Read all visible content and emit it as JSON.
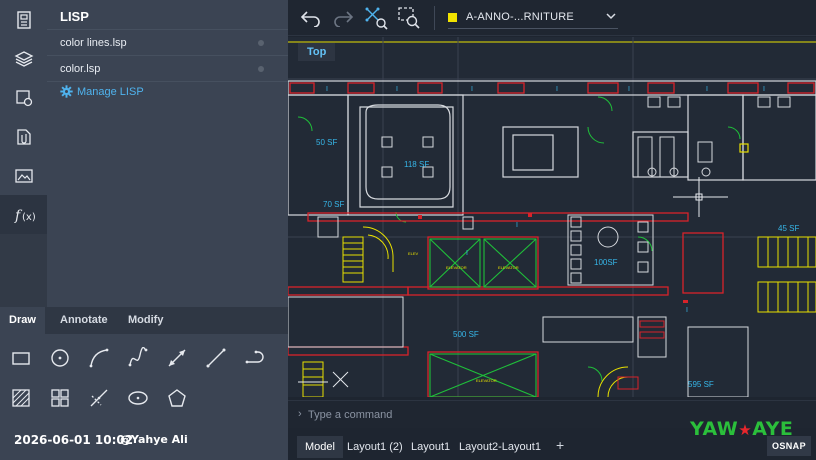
{
  "rail": {
    "icons": [
      "document-icon",
      "layers-icon",
      "blocks-icon",
      "attach-icon",
      "images-icon",
      "function-icon"
    ]
  },
  "lisp_panel": {
    "title": "LISP",
    "items": [
      {
        "label": "color lines.lsp"
      },
      {
        "label": "color.lsp"
      }
    ],
    "manage_label": "Manage LISP"
  },
  "tools": {
    "tabs": [
      {
        "label": "Draw",
        "active": true
      },
      {
        "label": "Annotate",
        "active": false
      },
      {
        "label": "Modify",
        "active": false
      }
    ]
  },
  "overlay": {
    "timestamp": "2026-06-01 10:02",
    "author": "@Yahye Ali"
  },
  "toolbar": {
    "layer_name": "A-ANNO-...RNITURE",
    "layer_color": "#f2e300"
  },
  "canvas": {
    "view_label": "Top",
    "room_labels": [
      {
        "label": "50 SF"
      },
      {
        "label": "118 SF"
      },
      {
        "label": "70 SF"
      },
      {
        "label": "100SF"
      },
      {
        "label": "500 SF"
      },
      {
        "label": "595 SF"
      },
      {
        "label": "45 SF"
      },
      {
        "label": "ELEVATOR"
      },
      {
        "label": "ELEVATOR"
      },
      {
        "label": "ELEVATOR"
      },
      {
        "label": "ELEV"
      }
    ]
  },
  "command": {
    "prompt": "›",
    "placeholder": "Type a command"
  },
  "layouts": {
    "tabs": [
      {
        "label": "Model",
        "active": true
      },
      {
        "label": "Layout1 (2)",
        "active": false
      },
      {
        "label": "Layout1",
        "active": false
      },
      {
        "label": "Layout2-Layout1",
        "active": false
      }
    ],
    "add_label": "+",
    "osnap_label": "OSNAP"
  },
  "watermark": {
    "part1": "YAW",
    "star": "★",
    "part2": "AYE"
  },
  "colors": {
    "accent": "#4fb3ee",
    "wall_red": "#d8232a",
    "line_yellow": "#e8e000",
    "line_green": "#1fbf3a",
    "line_cyan": "#36b6e8",
    "wall_white": "#d6d9de"
  }
}
